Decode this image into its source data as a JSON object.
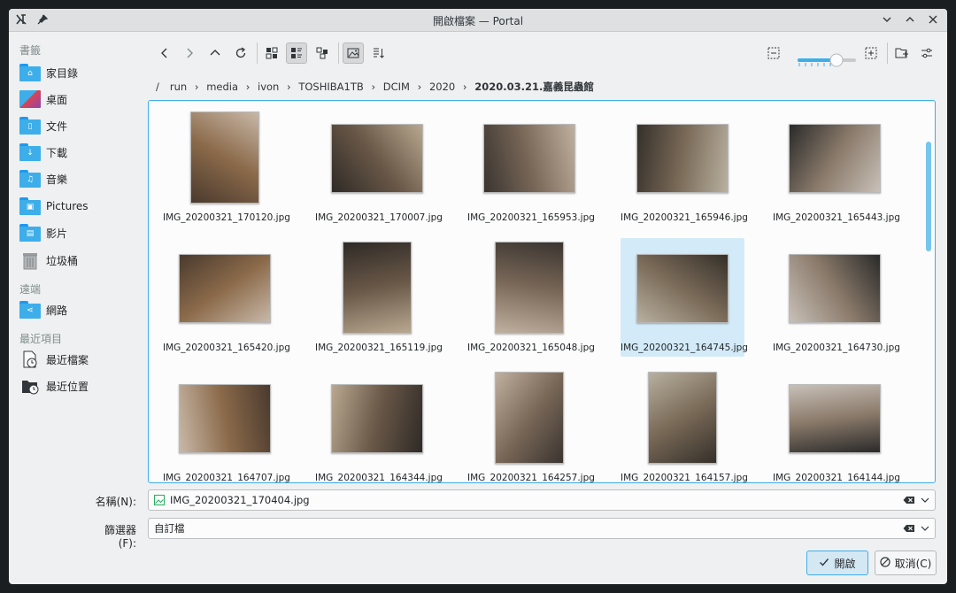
{
  "window": {
    "title": "開啟檔案 — Portal"
  },
  "sidebar": {
    "sections": [
      {
        "label": "書籤"
      },
      {
        "label": "遠端"
      },
      {
        "label": "最近項目"
      }
    ],
    "items": [
      {
        "label": "家目錄",
        "icon": "home-folder-icon"
      },
      {
        "label": "桌面",
        "icon": "desktop-icon"
      },
      {
        "label": "文件",
        "icon": "documents-folder-icon"
      },
      {
        "label": "下載",
        "icon": "downloads-folder-icon"
      },
      {
        "label": "音樂",
        "icon": "music-folder-icon"
      },
      {
        "label": "Pictures",
        "icon": "pictures-folder-icon"
      },
      {
        "label": "影片",
        "icon": "videos-folder-icon"
      },
      {
        "label": "垃圾桶",
        "icon": "trash-icon"
      },
      {
        "label": "網路",
        "icon": "network-folder-icon"
      },
      {
        "label": "最近檔案",
        "icon": "recent-files-icon"
      },
      {
        "label": "最近位置",
        "icon": "recent-locations-icon"
      }
    ]
  },
  "breadcrumb": {
    "root": "/",
    "parts": [
      "run",
      "media",
      "ivon",
      "TOSHIBA1TB",
      "DCIM",
      "2020"
    ],
    "current": "2020.03.21.嘉義昆蟲館"
  },
  "files": [
    {
      "name": "IMG_20200321_170120.jpg"
    },
    {
      "name": "IMG_20200321_170007.jpg"
    },
    {
      "name": "IMG_20200321_165953.jpg"
    },
    {
      "name": "IMG_20200321_165946.jpg"
    },
    {
      "name": "IMG_20200321_165443.jpg"
    },
    {
      "name": "IMG_20200321_165420.jpg"
    },
    {
      "name": "IMG_20200321_165119.jpg"
    },
    {
      "name": "IMG_20200321_165048.jpg"
    },
    {
      "name": "IMG_20200321_164745.jpg"
    },
    {
      "name": "IMG_20200321_164730.jpg"
    },
    {
      "name": "IMG_20200321_164707.jpg"
    },
    {
      "name": "IMG_20200321_164344.jpg"
    },
    {
      "name": "IMG_20200321_164257.jpg"
    },
    {
      "name": "IMG_20200321_164157.jpg"
    },
    {
      "name": "IMG_20200321_164144.jpg"
    }
  ],
  "selected_index": 8,
  "form": {
    "name_label": "名稱(N):",
    "name_value": "IMG_20200321_170404.jpg",
    "filter_label": "篩選器(F):",
    "filter_value": "自訂檔"
  },
  "buttons": {
    "open": "開啟",
    "cancel": "取消(C)"
  },
  "colors": {
    "accent": "#3daee9",
    "selection": "#d3ebf8"
  }
}
